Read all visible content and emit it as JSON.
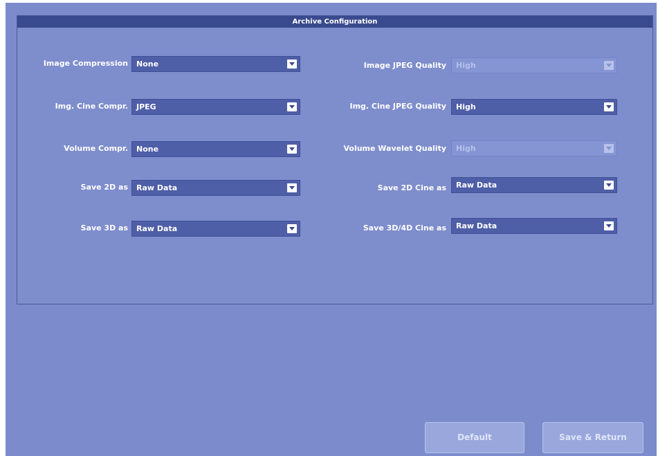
{
  "panel": {
    "title": "Archive Configuration"
  },
  "left": [
    {
      "label": "Image Compression",
      "value": "None"
    },
    {
      "label": "Img. Cine Compr.",
      "value": "JPEG"
    },
    {
      "label": "Volume Compr.",
      "value": "None"
    },
    {
      "label": "Save 2D as",
      "value": "Raw Data"
    },
    {
      "label": "Save 3D as",
      "value": "Raw Data"
    }
  ],
  "right": [
    {
      "label": "Image JPEG Quality",
      "value": "High",
      "disabled": true
    },
    {
      "label": "Img. Cine JPEG Quality",
      "value": "High",
      "disabled": false
    },
    {
      "label": "Volume Wavelet Quality",
      "value": "High",
      "disabled": true
    },
    {
      "label": "Save 2D Cine as",
      "value": "Raw Data",
      "disabled": false
    },
    {
      "label": "Save 3D/4D Cine as",
      "value": "Raw Data",
      "disabled": false
    }
  ],
  "buttons": {
    "default": "Default",
    "save_return": "Save & Return"
  },
  "icons": {
    "dropdown": "chevron-down-icon"
  }
}
